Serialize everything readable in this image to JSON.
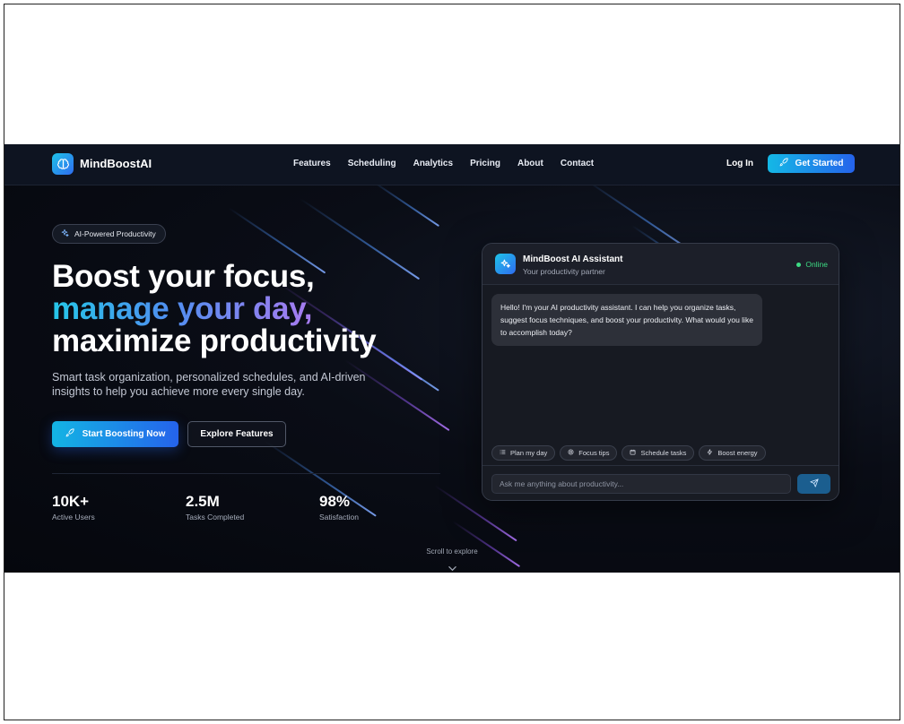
{
  "nav": {
    "brand": "MindBoostAI",
    "links": [
      {
        "label": "Features"
      },
      {
        "label": "Scheduling"
      },
      {
        "label": "Analytics"
      },
      {
        "label": "Pricing"
      },
      {
        "label": "About"
      },
      {
        "label": "Contact"
      }
    ],
    "login_label": "Log In",
    "cta_label": "Get Started"
  },
  "hero": {
    "badge": "AI-Powered Productivity",
    "headline_line1": "Boost your focus,",
    "headline_line2": "manage your day,",
    "headline_line3": "maximize productivity",
    "subtitle": "Smart task organization, personalized schedules, and AI-driven insights to help you achieve more every single day.",
    "primary_button": "Start Boosting Now",
    "secondary_button": "Explore Features",
    "stats": [
      {
        "value": "10K+",
        "label": "Active Users"
      },
      {
        "value": "2.5M",
        "label": "Tasks Completed"
      },
      {
        "value": "98%",
        "label": "Satisfaction"
      }
    ],
    "scroll_hint": "Scroll to explore"
  },
  "chat": {
    "title": "MindBoost AI Assistant",
    "subtitle": "Your productivity partner",
    "status": "Online",
    "message": "Hello! I'm your AI productivity assistant. I can help you organize tasks, suggest focus techniques, and boost your productivity. What would you like to accomplish today?",
    "chips": [
      {
        "label": "Plan my day",
        "icon": "list-icon"
      },
      {
        "label": "Focus tips",
        "icon": "target-icon"
      },
      {
        "label": "Schedule tasks",
        "icon": "calendar-icon"
      },
      {
        "label": "Boost energy",
        "icon": "bolt-icon"
      }
    ],
    "input_placeholder": "Ask me anything about productivity...",
    "send_icon": "send-icon"
  },
  "colors": {
    "accent_start": "#13b4e4",
    "accent_end": "#2563eb",
    "gradient_purple": "#a87bf0",
    "online_green": "#3ddc84",
    "background": "#05070d"
  }
}
